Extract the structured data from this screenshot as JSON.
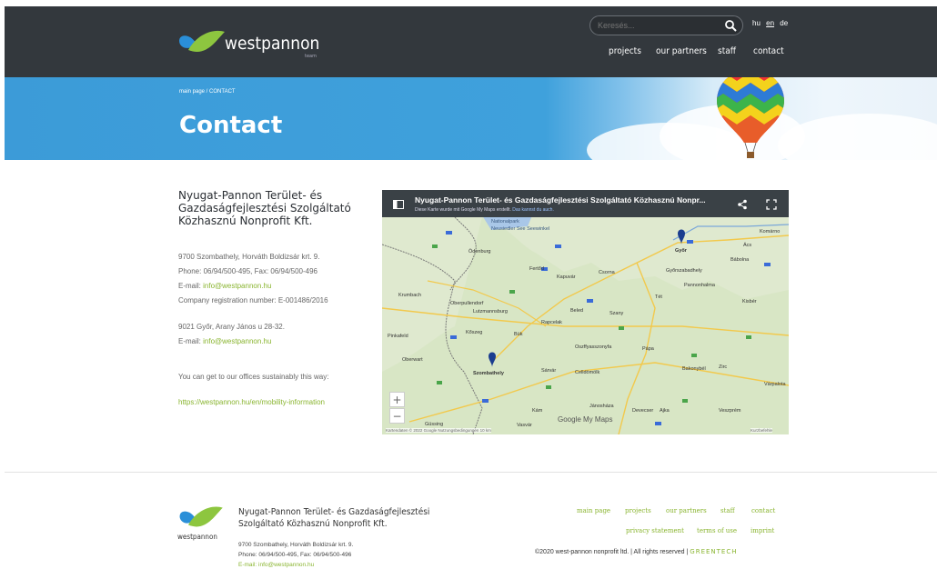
{
  "header": {
    "logo_text": "westpannon",
    "logo_sub": "team",
    "search_placeholder": "Keresés...",
    "languages": [
      "hu",
      "en",
      "de"
    ],
    "active_language": "en",
    "nav": [
      "projects",
      "our partners",
      "staff",
      "contact"
    ]
  },
  "banner": {
    "breadcrumb": "main page / CONTACT",
    "title": "Contact"
  },
  "contact": {
    "org_name": "Nyugat-Pannon Terület- és Gazdaságfejlesztési Szolgáltató Közhasznú Nonprofit Kft.",
    "address1": "9700 Szombathely, Horváth Boldizsár krt. 9.",
    "phone": "Phone: 06/94/500-495, Fax: 06/94/500-496",
    "email_label": "E-mail: ",
    "email": "info@westpannon.hu",
    "registration": "Company registration number: E-001486/2016",
    "address2": "9021 Győr, Arany János u 28-32.",
    "email2_label": "E-mail: ",
    "email2": "info@westpannon.hu",
    "sustain_text": "You can get to our offices sustainably this way:",
    "mobility_link": "https://westpannon.hu/en/mobility-information"
  },
  "map": {
    "title": "Nyugat-Pannon Terület- és Gazdaságfejlesztési Szolgáltató Közhasznú Nonpr...",
    "subtitle": "Diese Karte wurde mit Google My Maps erstellt.",
    "subtitle_link": "Das kannst du auch.",
    "places": [
      "Ödenburg",
      "Győr",
      "Ács",
      "Komárno",
      "Bábolna",
      "Fertőd",
      "Kapuvár",
      "Csorna",
      "Győrszabadhely",
      "Pannonhalma",
      "Krumbach",
      "Oberpullendorf",
      "Lutzmannsburg",
      "Tét",
      "Kisbér",
      "Beled",
      "Szany",
      "Rapcelak",
      "Kőszeg",
      "Bük",
      "Pinkafeld",
      "Pápa",
      "Oszffyasszonyfa",
      "Oberwart",
      "Szombathely",
      "Sárvár",
      "Celldömölk",
      "Bakonybél",
      "Zirc",
      "Várpalota",
      "Kám",
      "Jánosháza",
      "Devecser",
      "Ajka",
      "Veszprém",
      "Güssing",
      "Vasvár",
      "Neusiedler See Seewinkel",
      "Nationalpark"
    ],
    "attribution": "Kartendaten © 2022 Google   Nutzungsbedingungen   10 km",
    "brand": "Google My Maps",
    "shortcuts": "Kurzbefehle"
  },
  "footer": {
    "org_name": "Nyugat-Pannon Terület- és Gazdaságfejlesztési Szolgáltató Közhasznú Nonprofit Kft.",
    "logo_text": "westpannon",
    "address": "9700 Szombathely, Horváth Boldizsár krt. 9.",
    "phone": "Phone: 06/94/500-495, Fax: 06/94/500-496",
    "email": "E-mail: info@westpannon.hu",
    "links_row1": [
      "main page",
      "projects",
      "our partners",
      "staff",
      "contact"
    ],
    "links_row2": [
      "privacy statement",
      "terms of use",
      "imprint"
    ],
    "copyright": "©2020 west-pannon nonprofit ltd. | All rights reserved | ",
    "greentech": "GREENTECH"
  },
  "colors": {
    "header_bg": "#33383d",
    "banner_blue": "#3c9bd8",
    "accent_green": "#8ab531",
    "logo_blue": "#2a8fd8",
    "logo_green": "#8dc63f"
  }
}
